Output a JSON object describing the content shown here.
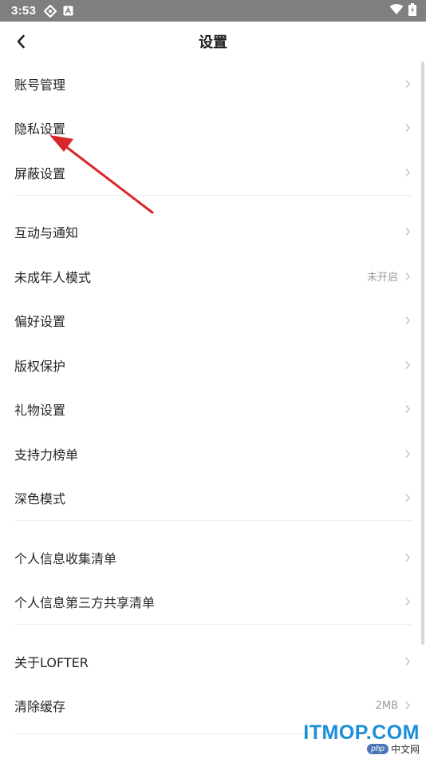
{
  "status_bar": {
    "time": "3:53",
    "left_icons": [
      "sync-icon",
      "a-badge-icon"
    ],
    "right_icons": [
      "wifi-icon",
      "battery-charging-icon"
    ]
  },
  "header": {
    "title": "设置",
    "back_icon": "chevron-left-icon"
  },
  "menu": {
    "groups": [
      {
        "items": [
          {
            "id": "account",
            "label": "账号管理",
            "value": ""
          },
          {
            "id": "privacy",
            "label": "隐私设置",
            "value": ""
          },
          {
            "id": "block",
            "label": "屏蔽设置",
            "value": ""
          }
        ]
      },
      {
        "items": [
          {
            "id": "notify",
            "label": "互动与通知",
            "value": ""
          },
          {
            "id": "minor",
            "label": "未成年人模式",
            "value": "未开启"
          },
          {
            "id": "preference",
            "label": "偏好设置",
            "value": ""
          },
          {
            "id": "copyright",
            "label": "版权保护",
            "value": ""
          },
          {
            "id": "gift",
            "label": "礼物设置",
            "value": ""
          },
          {
            "id": "support",
            "label": "支持力榜单",
            "value": ""
          },
          {
            "id": "dark",
            "label": "深色模式",
            "value": ""
          }
        ]
      },
      {
        "items": [
          {
            "id": "info-collect",
            "label": "个人信息收集清单",
            "value": ""
          },
          {
            "id": "info-share",
            "label": "个人信息第三方共享清单",
            "value": ""
          }
        ]
      },
      {
        "items": [
          {
            "id": "about",
            "label": "关于LOFTER",
            "value": ""
          },
          {
            "id": "cache",
            "label": "清除缓存",
            "value": "2MB"
          }
        ]
      }
    ]
  },
  "colors": {
    "status_bar_bg": "#7f7f7f",
    "annotation_arrow": "#d9262b",
    "chevron": "#c4c4c4",
    "secondary_text": "#999999"
  },
  "watermark": {
    "main": "ITMOP.COM",
    "badge": "php",
    "sub": "中文网"
  }
}
